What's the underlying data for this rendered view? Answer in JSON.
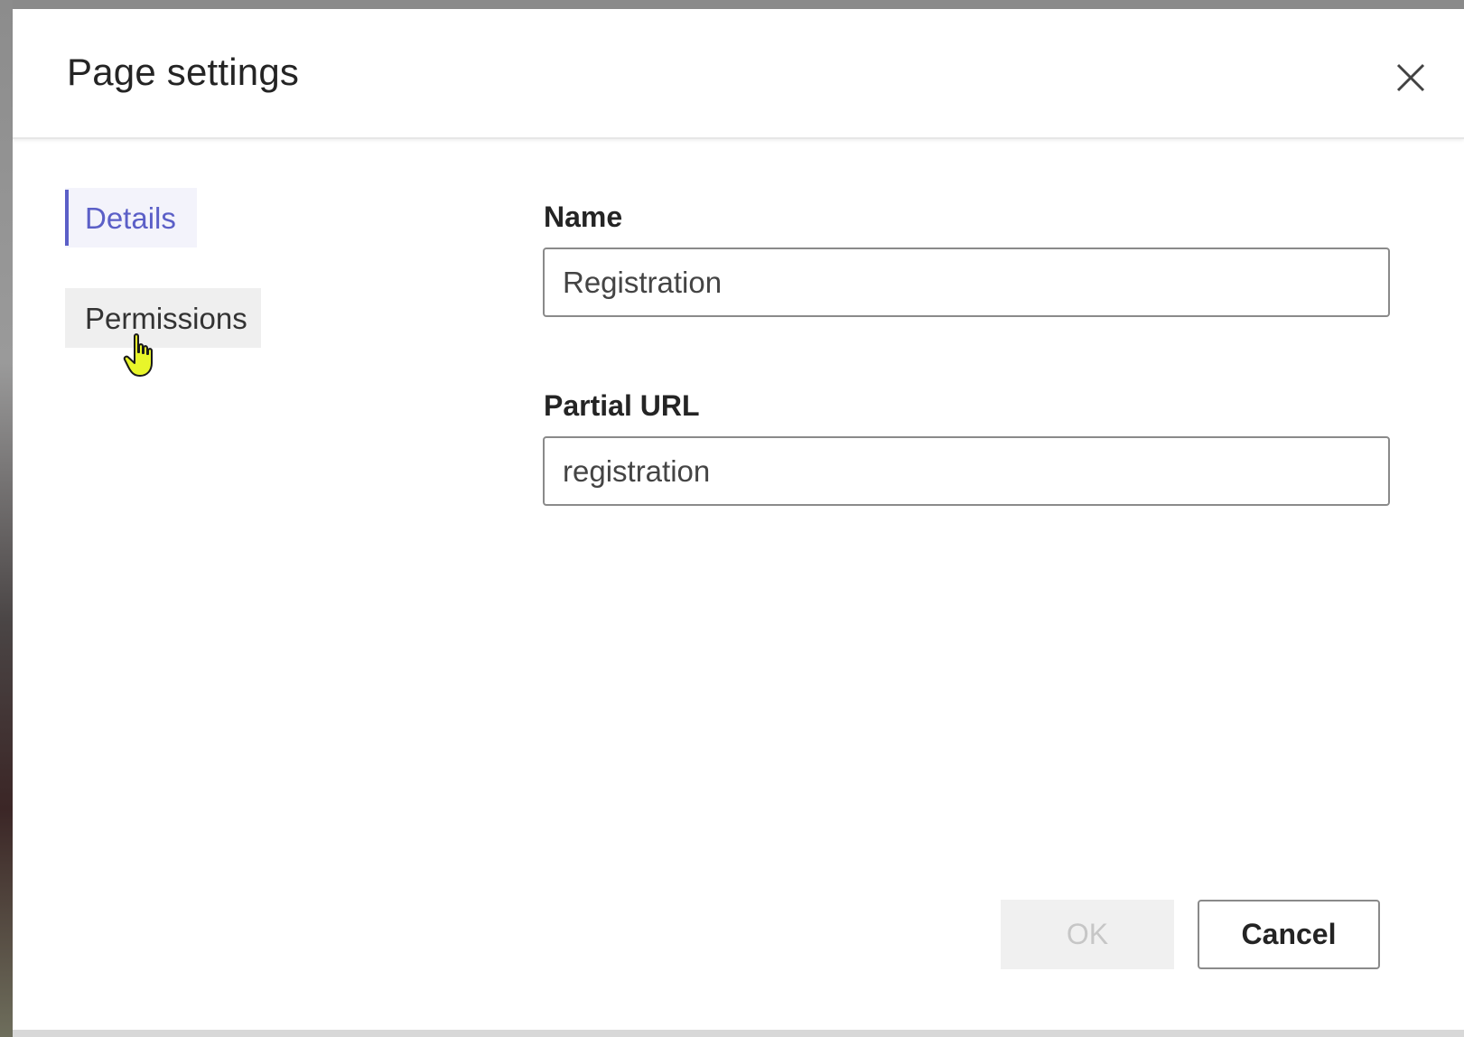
{
  "dialog": {
    "title": "Page settings",
    "close_icon": "close-icon"
  },
  "nav": {
    "items": [
      {
        "label": "Details",
        "active": true
      },
      {
        "label": "Permissions",
        "active": false,
        "hovered": true
      }
    ]
  },
  "form": {
    "name": {
      "label": "Name",
      "value": "Registration"
    },
    "partial_url": {
      "label": "Partial URL",
      "value": "registration"
    }
  },
  "footer": {
    "ok_label": "OK",
    "ok_disabled": true,
    "cancel_label": "Cancel"
  },
  "colors": {
    "accent": "#5b5fc7",
    "cursor": "#e8f52a"
  }
}
